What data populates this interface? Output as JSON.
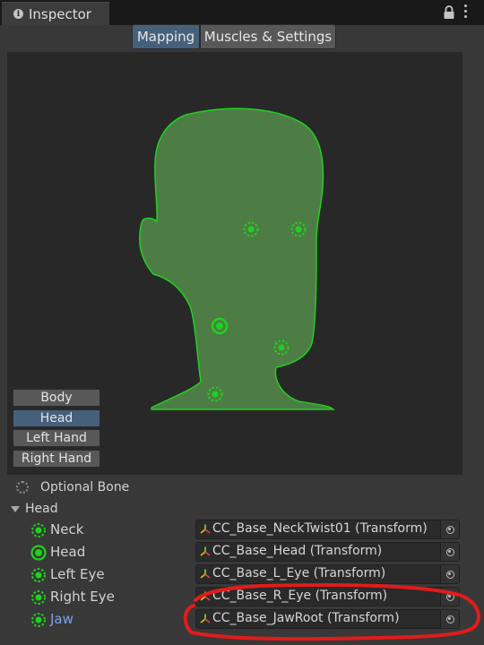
{
  "window": {
    "tab_title": "Inspector"
  },
  "mode_tabs": [
    {
      "label": "Mapping",
      "active": true
    },
    {
      "label": "Muscles & Settings",
      "active": false
    }
  ],
  "body_parts": [
    {
      "label": "Body",
      "active": false
    },
    {
      "label": "Head",
      "active": true
    },
    {
      "label": "Left Hand",
      "active": false
    },
    {
      "label": "Right Hand",
      "active": false
    }
  ],
  "legend": {
    "optional_bone": "Optional Bone"
  },
  "section": {
    "title": "Head",
    "expanded": true
  },
  "bones": [
    {
      "label": "Neck",
      "value": "CC_Base_NeckTwist01 (Transform)",
      "required": false,
      "selected": false
    },
    {
      "label": "Head",
      "value": "CC_Base_Head (Transform)",
      "required": true,
      "selected": false
    },
    {
      "label": "Left Eye",
      "value": "CC_Base_L_Eye (Transform)",
      "required": false,
      "selected": false
    },
    {
      "label": "Right Eye",
      "value": "CC_Base_R_Eye (Transform)",
      "required": false,
      "selected": false
    },
    {
      "label": "Jaw",
      "value": "CC_Base_JawRoot (Transform)",
      "required": false,
      "selected": true
    }
  ],
  "colors": {
    "bone_mapped": "#1fd11f",
    "head_fill": "#4d7d45",
    "selection_blue": "#46607c",
    "annotation_red": "#e31b1b"
  }
}
